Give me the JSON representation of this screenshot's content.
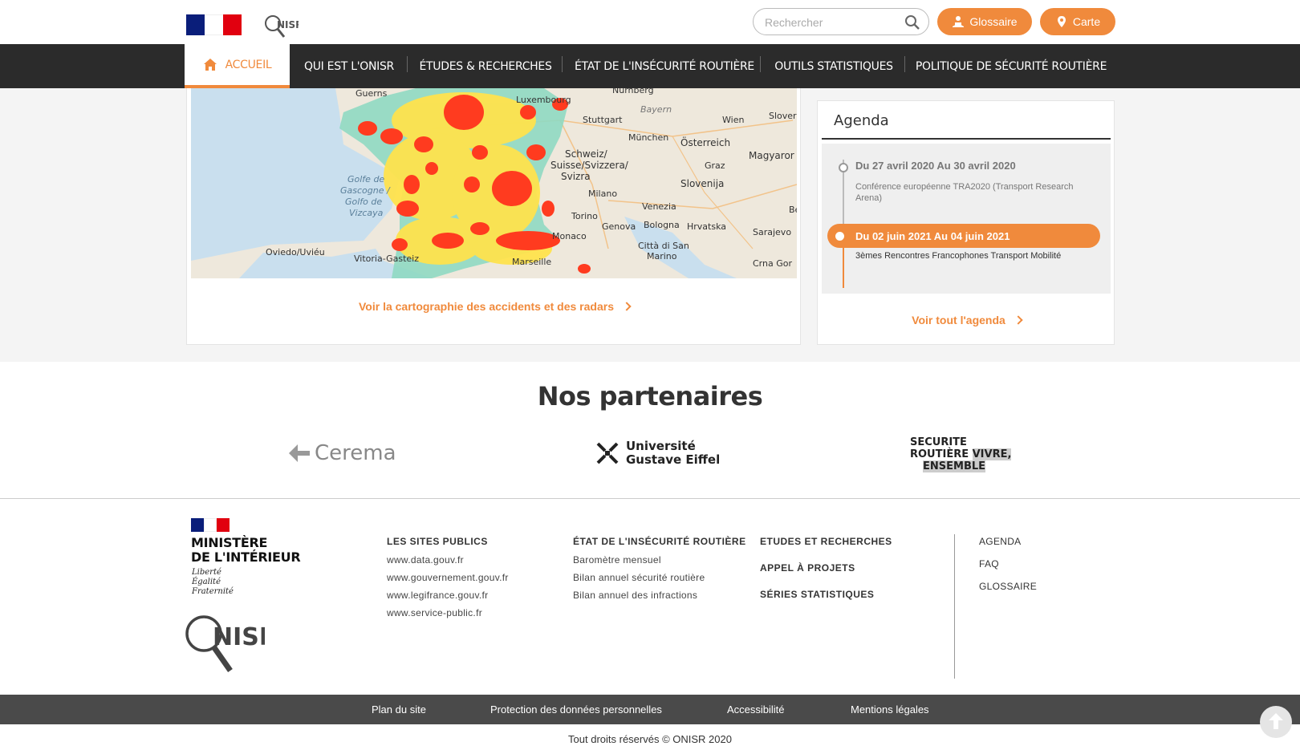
{
  "header": {
    "search_placeholder": "Rechercher",
    "glossaire_label": "Glossaire",
    "carte_label": "Carte",
    "logo_text": "NISR"
  },
  "nav": {
    "items": [
      {
        "label": "ACCUEIL"
      },
      {
        "label": "QUI EST L'ONISR"
      },
      {
        "label": "ÉTUDES & RECHERCHES"
      },
      {
        "label": "ÉTAT DE L'INSÉCURITÉ ROUTIÈRE"
      },
      {
        "label": "OUTILS STATISTIQUES"
      },
      {
        "label": "POLITIQUE DE SÉCURITÉ ROUTIÈRE"
      }
    ]
  },
  "map": {
    "labels": {
      "guerns": "Guerns",
      "luxembourg": "Luxembourg",
      "nurnberg": "Nürnberg",
      "bayern": "Bayern",
      "stuttgart": "Stuttgart",
      "munchen": "München",
      "wien": "Wien",
      "slover": "Slover",
      "osterreich": "Österreich",
      "magyar": "Magyaror",
      "schweiz": "Schweiz/",
      "suisse": "Suisse/Svizzera/",
      "svizra": "Svizra",
      "graz": "Graz",
      "slovenija": "Slovenija",
      "milano": "Milano",
      "golfe1": "Golfe de",
      "golfe2": "Gascogne /",
      "golfe3": "Golfo de",
      "golfe4": "Vizcaya",
      "venezia": "Venezia",
      "torino": "Torino",
      "genova": "Genova",
      "bologna": "Bologna",
      "hrvatska": "Hrvatska",
      "sarajevo": "Sarajevo",
      "monaco": "Monaco",
      "oviedo": "Oviedo/Uviéu",
      "vitoria": "Vitoria-Gasteiz",
      "marseille": "Marseille",
      "sanmarino1": "Città di San",
      "sanmarino2": "Marino",
      "crnagor": "Crna Gor",
      "be": "Be"
    },
    "link_label": "Voir la cartographie des accidents et des radars"
  },
  "agenda": {
    "title": "Agenda",
    "events": [
      {
        "date": "Du  27 avril 2020 Au  30 avril 2020",
        "desc": "Conférence européenne TRA2020 (Transport Research Arena)"
      },
      {
        "date": "Du  02 juin 2021 Au  04 juin 2021",
        "desc": "3èmes Rencontres Francophones Transport Mobilité"
      }
    ],
    "link_label": "Voir tout l'agenda"
  },
  "partners": {
    "title": "Nos partenaires",
    "cerema": "Cerema",
    "uge_line1": "Université",
    "uge_line2": "Gustave Eiffel",
    "sr_line1": "SECURITE",
    "sr_line2a": "ROUTIÈRE",
    "sr_line2b": "VIVRE,",
    "sr_line3": "ENSEMBLE"
  },
  "footer": {
    "ministry_line1": "MINISTÈRE",
    "ministry_line2": "DE L'INTÉRIEUR",
    "motto": [
      "Liberté",
      "Égalité",
      "Fraternité"
    ],
    "logo_text": "NISR",
    "col1": {
      "heading": "LES SITES PUBLICS",
      "links": [
        "www.data.gouv.fr",
        "www.gouvernement.gouv.fr",
        "www.legifrance.gouv.fr",
        "www.service-public.fr"
      ]
    },
    "col2": {
      "heading": "ÉTAT DE L'INSÉCURITÉ ROUTIÈRE",
      "links": [
        "Baromètre mensuel",
        "Bilan annuel sécurité routière",
        "Bilan annuel des infractions"
      ]
    },
    "col3": {
      "headings": [
        "ETUDES ET RECHERCHES",
        "APPEL À PROJETS",
        "SÉRIES STATISTIQUES"
      ]
    },
    "col4": {
      "links": [
        "AGENDA",
        "FAQ",
        "GLOSSAIRE"
      ]
    },
    "bottom_links": [
      "Plan du site",
      "Protection des données personnelles",
      "Accessibilité",
      "Mentions légales"
    ],
    "copyright": "Tout droits réservés © ONISR 2020"
  },
  "colors": {
    "accent": "#f08a3c",
    "nav_bg": "#2b2b2b",
    "footer_bar": "#4a4a4a"
  }
}
